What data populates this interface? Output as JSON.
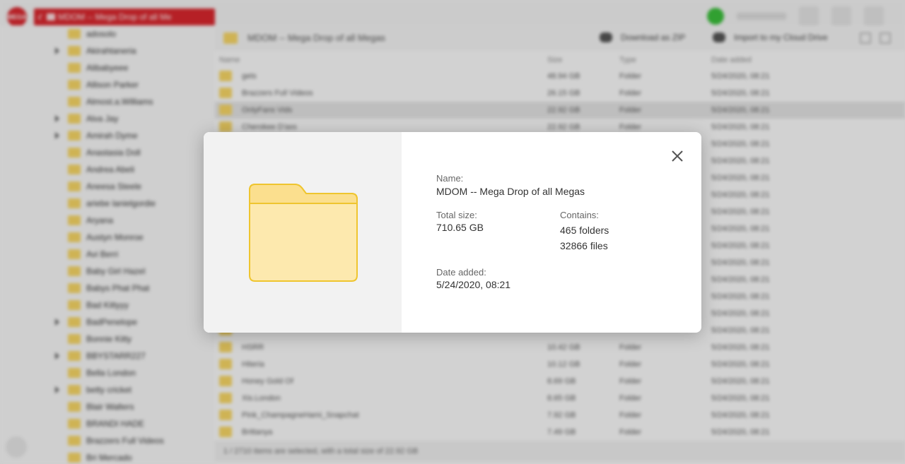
{
  "topbar": {
    "logo_text": "MEGA",
    "path_text": "MDOM -- Mega Drop of all Me"
  },
  "sidebar": {
    "items": [
      {
        "label": "adosolo",
        "expandable": false
      },
      {
        "label": "Akirahtaneria",
        "expandable": true
      },
      {
        "label": "Alibabyeee",
        "expandable": false
      },
      {
        "label": "Allison Parker",
        "expandable": false
      },
      {
        "label": "Almost.a.Williams",
        "expandable": false
      },
      {
        "label": "Alva Jay",
        "expandable": true
      },
      {
        "label": "Amirah Dyme",
        "expandable": true
      },
      {
        "label": "Anastasia Doll",
        "expandable": false
      },
      {
        "label": "Andrea Abeli",
        "expandable": false
      },
      {
        "label": "Aneesa Steele",
        "expandable": false
      },
      {
        "label": "ariebe lanielgordie",
        "expandable": false
      },
      {
        "label": "Aryana",
        "expandable": false
      },
      {
        "label": "Austyn Monroe",
        "expandable": false
      },
      {
        "label": "Avi Berri",
        "expandable": false
      },
      {
        "label": "Baby Girl Hazel",
        "expandable": false
      },
      {
        "label": "Babys Phat Phat",
        "expandable": false
      },
      {
        "label": "Bad Kittyyy",
        "expandable": false
      },
      {
        "label": "BadPenelope",
        "expandable": true
      },
      {
        "label": "Bonnie Kitty",
        "expandable": false
      },
      {
        "label": "BBYSTARR227",
        "expandable": true
      },
      {
        "label": "Bella London",
        "expandable": false
      },
      {
        "label": "betty cricket",
        "expandable": true
      },
      {
        "label": "Blair Walters",
        "expandable": false
      },
      {
        "label": "BRANDI HADE",
        "expandable": false
      },
      {
        "label": "Brazzers Full Videos",
        "expandable": false
      },
      {
        "label": "Bri Mercado",
        "expandable": false
      }
    ]
  },
  "main": {
    "title": "MDOM -- Mega Drop of all Megas",
    "download_label": "Download as ZIP",
    "import_label": "Import to my Cloud Drive",
    "columns": {
      "name": "Name",
      "size": "Size",
      "type": "Type",
      "date": "Date added"
    },
    "rows": [
      {
        "name": "gets",
        "size": "48.94 GB",
        "type": "Folder",
        "date": "5/24/2020, 08:21",
        "selected": false
      },
      {
        "name": "Brazzers Full Videos",
        "size": "26.15 GB",
        "type": "Folder",
        "date": "5/24/2020, 08:21",
        "selected": false
      },
      {
        "name": "OnlyFans Vids",
        "size": "22.92 GB",
        "type": "Folder",
        "date": "5/24/2020, 08:21",
        "selected": true
      },
      {
        "name": "Cherokee D'ass",
        "size": "22.92 GB",
        "type": "Folder",
        "date": "5/24/2020, 08:21",
        "selected": false
      },
      {
        "name": "",
        "size": "",
        "type": "",
        "date": "5/24/2020, 08:21",
        "selected": false
      },
      {
        "name": "",
        "size": "",
        "type": "",
        "date": "5/24/2020, 08:21",
        "selected": false
      },
      {
        "name": "",
        "size": "",
        "type": "",
        "date": "5/24/2020, 08:21",
        "selected": false
      },
      {
        "name": "",
        "size": "",
        "type": "",
        "date": "5/24/2020, 08:21",
        "selected": false
      },
      {
        "name": "",
        "size": "",
        "type": "",
        "date": "5/24/2020, 08:21",
        "selected": false
      },
      {
        "name": "",
        "size": "",
        "type": "",
        "date": "5/24/2020, 08:21",
        "selected": false
      },
      {
        "name": "",
        "size": "",
        "type": "",
        "date": "5/24/2020, 08:21",
        "selected": false
      },
      {
        "name": "",
        "size": "",
        "type": "",
        "date": "5/24/2020, 08:21",
        "selected": false
      },
      {
        "name": "",
        "size": "",
        "type": "",
        "date": "5/24/2020, 08:21",
        "selected": false
      },
      {
        "name": "",
        "size": "",
        "type": "",
        "date": "5/24/2020, 08:21",
        "selected": false
      },
      {
        "name": "",
        "size": "",
        "type": "",
        "date": "5/24/2020, 08:21",
        "selected": false
      },
      {
        "name": "",
        "size": "",
        "type": "",
        "date": "5/24/2020, 08:21",
        "selected": false
      },
      {
        "name": "HSRR",
        "size": "10.42 GB",
        "type": "Folder",
        "date": "5/24/2020, 08:21",
        "selected": false
      },
      {
        "name": "Hiteria",
        "size": "10.12 GB",
        "type": "Folder",
        "date": "5/24/2020, 08:21",
        "selected": false
      },
      {
        "name": "Honey Gold Of",
        "size": "8.69 GB",
        "type": "Folder",
        "date": "5/24/2020, 08:21",
        "selected": false
      },
      {
        "name": "Xis.London",
        "size": "8.65 GB",
        "type": "Folder",
        "date": "5/24/2020, 08:21",
        "selected": false
      },
      {
        "name": "Pink_ChampagneHami_Snapchat",
        "size": "7.92 GB",
        "type": "Folder",
        "date": "5/24/2020, 08:21",
        "selected": false
      },
      {
        "name": "Brittanya",
        "size": "7.49 GB",
        "type": "Folder",
        "date": "5/24/2020, 08:21",
        "selected": false
      }
    ]
  },
  "status_text": "1 / 2710 items are selected, with a total size of 22.92 GB",
  "dialog": {
    "name_label": "Name:",
    "name_value": "MDOM -- Mega Drop of all Megas",
    "size_label": "Total size:",
    "size_value": "710.65 GB",
    "contains_label": "Contains:",
    "folders_value": "465 folders",
    "files_value": "32866 files",
    "date_label": "Date added:",
    "date_value": "5/24/2020, 08:21",
    "folder_icon": "folder-icon",
    "close_icon": "close-icon"
  },
  "colors": {
    "brand_red": "#d9272e",
    "folder_fill": "#fde9ae",
    "folder_tab": "#fbdf8e",
    "folder_stroke": "#efc52f"
  }
}
